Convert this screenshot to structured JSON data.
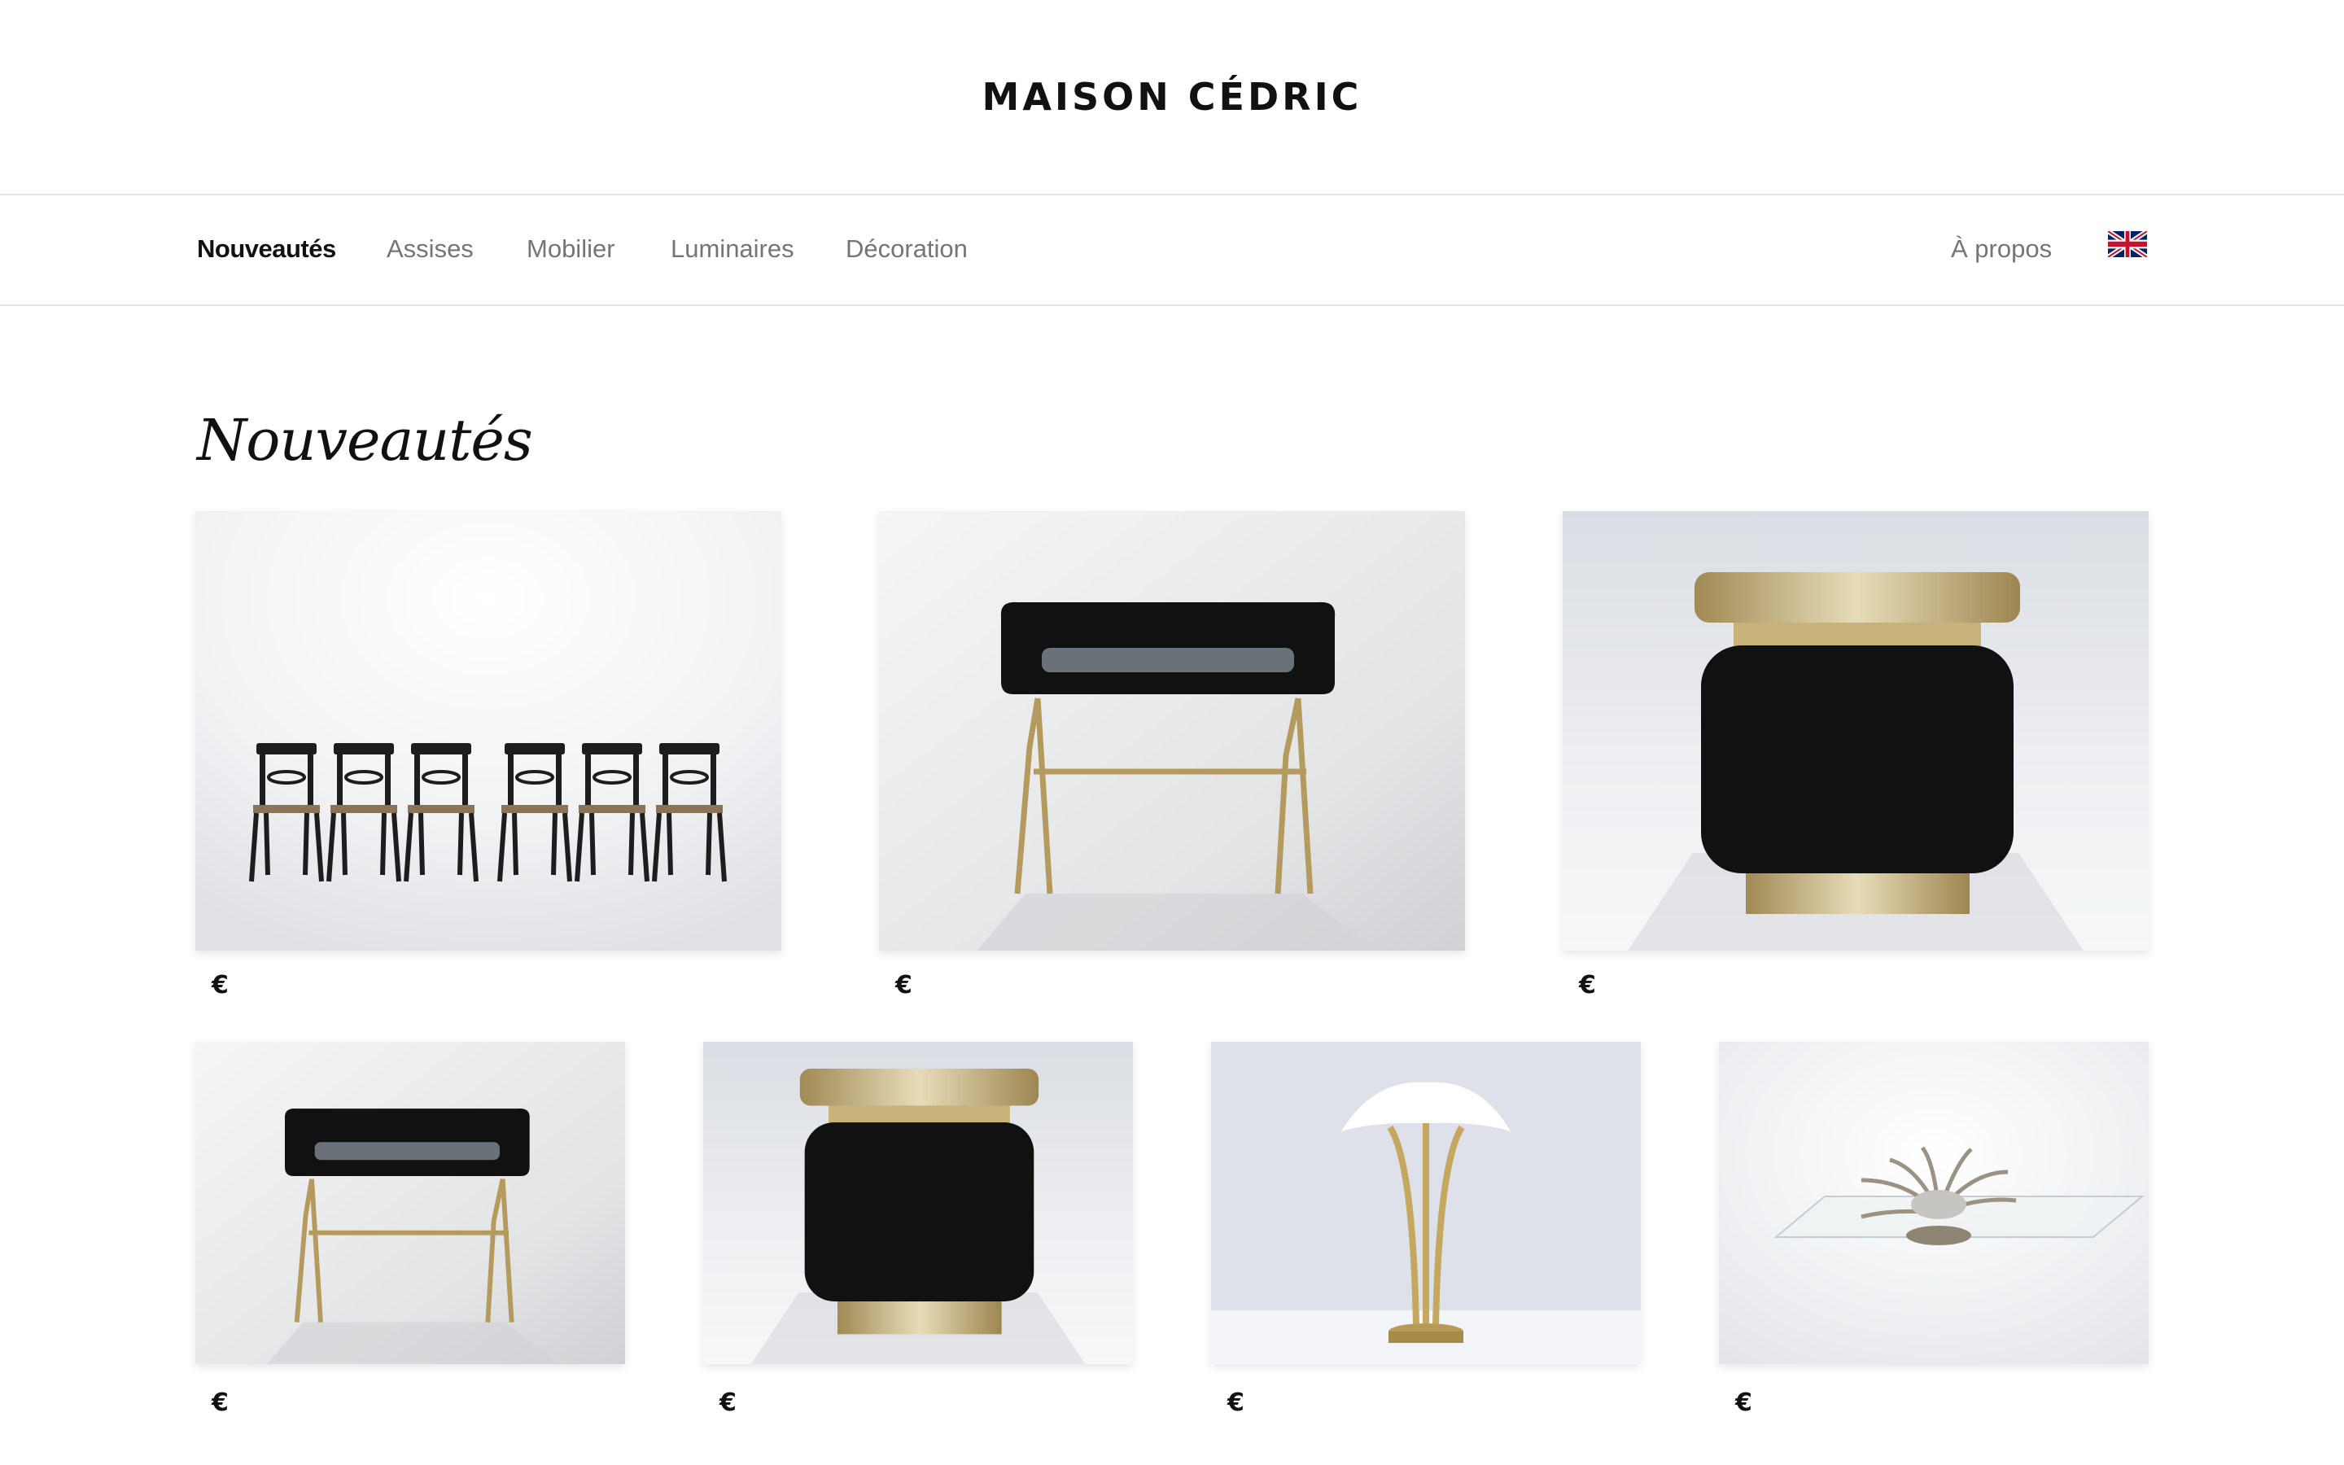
{
  "brand": "MAISON CÉDRIC",
  "nav": {
    "items": [
      {
        "label": "Nouveautés",
        "active": true
      },
      {
        "label": "Assises"
      },
      {
        "label": "Mobilier"
      },
      {
        "label": "Luminaires"
      },
      {
        "label": "Décoration"
      }
    ],
    "about": "À propos",
    "language_icon": "uk-flag-icon"
  },
  "page_title": "Nouveautés",
  "products": [
    {
      "image": "set-of-six-chairs",
      "price": "€"
    },
    {
      "image": "black-lacquer-tray-table",
      "price": "€"
    },
    {
      "image": "black-and-brass-cabinet",
      "price": "€"
    },
    {
      "image": "black-lacquer-tray-table",
      "price": "€"
    },
    {
      "image": "black-and-brass-cabinet",
      "price": "€"
    },
    {
      "image": "brass-table-lamp",
      "price": "€"
    },
    {
      "image": "glass-coffee-table",
      "price": "€"
    }
  ],
  "colors": {
    "text": "#111111",
    "nav_muted": "#757575",
    "divider": "#e2e2e2",
    "photo_background": "#e9ebee"
  }
}
